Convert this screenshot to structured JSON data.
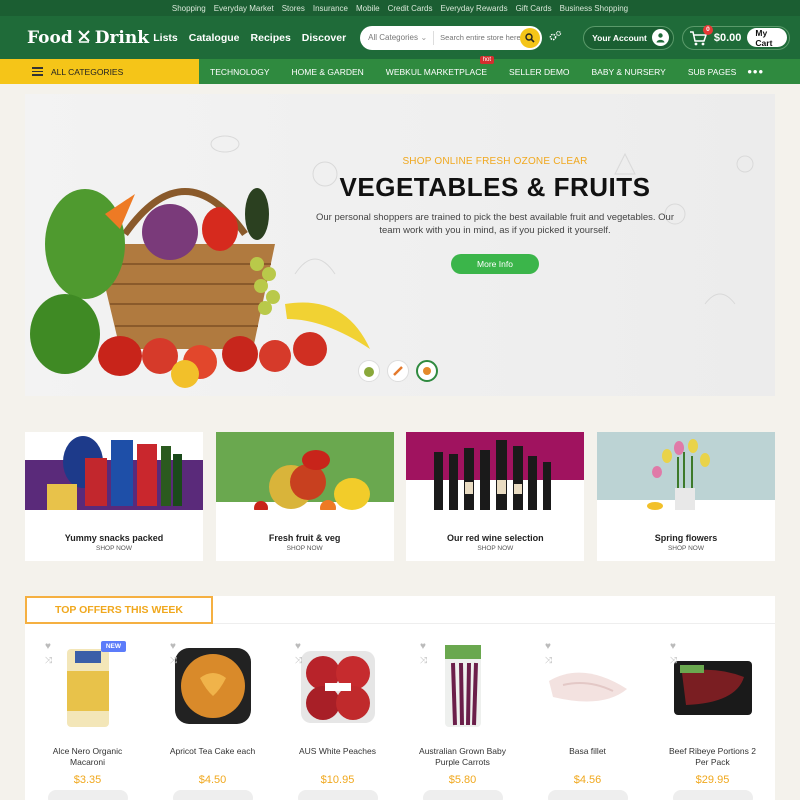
{
  "topbar": [
    "Shopping",
    "Everyday Market",
    "Stores",
    "Insurance",
    "Mobile",
    "Credit Cards",
    "Everyday Rewards",
    "Gift Cards",
    "Business Shopping"
  ],
  "header": {
    "logo_left": "Food",
    "logo_right": "Drink",
    "nav": [
      "Lists",
      "Catalogue",
      "Recipes",
      "Discover"
    ],
    "search_category": "All Categories",
    "search_placeholder": "Search entire store here...",
    "account_label": "Your Account",
    "cart_count": "0",
    "cart_total": "$0.00",
    "cart_label": "My Cart"
  },
  "catbar": {
    "all_categories": "ALL CATEGORIES",
    "items": [
      "TECHNOLOGY",
      "HOME & GARDEN",
      "WEBKUL MARKETPLACE",
      "SELLER DEMO",
      "BABY & NURSERY",
      "SUB PAGES"
    ],
    "hot_badge": "hot",
    "more": "•••"
  },
  "hero": {
    "kicker": "SHOP ONLINE FRESH OZONE CLEAR",
    "title": "VEGETABLES & FRUITS",
    "body": "Our personal shoppers are trained to pick the best available fruit and vegetables. Our team work with you in mind, as if you picked it yourself.",
    "button": "More Info"
  },
  "cards": [
    {
      "name": "Yummy snacks packed",
      "cta": "SHOP NOW",
      "color": "#5a2a7a"
    },
    {
      "name": "Fresh fruit & veg",
      "cta": "SHOP NOW",
      "color": "#6aa84f"
    },
    {
      "name": "Our red wine selection",
      "cta": "SHOP NOW",
      "color": "#a0135f"
    },
    {
      "name": "Spring flowers",
      "cta": "SHOP NOW",
      "color": "#bcd3d4"
    }
  ],
  "offers": {
    "title": "TOP OFFERS THIS WEEK",
    "new_badge": "NEW",
    "products": [
      {
        "name": "Alce Nero Organic Macaroni",
        "price": "$3.35"
      },
      {
        "name": "Apricot Tea Cake each",
        "price": "$4.50"
      },
      {
        "name": "AUS White Peaches",
        "price": "$10.95"
      },
      {
        "name": "Australian Grown Baby Purple Carrots",
        "price": "$5.80"
      },
      {
        "name": "Basa fillet",
        "price": "$4.56"
      },
      {
        "name": "Beef Ribeye Portions 2 Per Pack",
        "price": "$29.95"
      }
    ]
  },
  "colors": {
    "header_green": "#1f6b39",
    "catbar_green": "#2f8a3f",
    "accent_yellow": "#f5c518",
    "price_orange": "#f0a81e"
  }
}
